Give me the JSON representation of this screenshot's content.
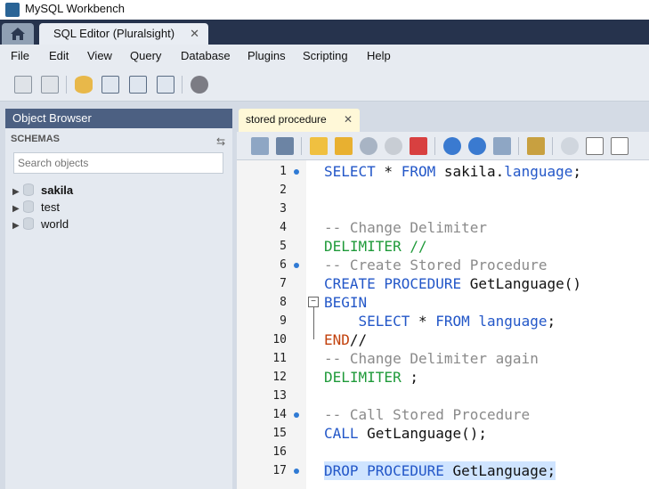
{
  "app": {
    "title": "MySQL Workbench"
  },
  "tabs": {
    "main_tab": "SQL Editor (Pluralsight)"
  },
  "menu": [
    "File",
    "Edit",
    "View",
    "Query",
    "Database",
    "Plugins",
    "Scripting",
    "Help"
  ],
  "object_browser": {
    "title": "Object Browser",
    "schemas_label": "SCHEMAS",
    "search_placeholder": "Search objects",
    "schemas": [
      "sakila",
      "test",
      "world"
    ]
  },
  "editor": {
    "tab_label": "stored procedure",
    "lines": [
      {
        "n": "1",
        "dot": true
      },
      {
        "n": "2",
        "dot": false
      },
      {
        "n": "3",
        "dot": false
      },
      {
        "n": "4",
        "dot": false
      },
      {
        "n": "5",
        "dot": false
      },
      {
        "n": "6",
        "dot": true
      },
      {
        "n": "7",
        "dot": false
      },
      {
        "n": "8",
        "dot": false
      },
      {
        "n": "9",
        "dot": false
      },
      {
        "n": "10",
        "dot": false
      },
      {
        "n": "11",
        "dot": false
      },
      {
        "n": "12",
        "dot": false
      },
      {
        "n": "13",
        "dot": false
      },
      {
        "n": "14",
        "dot": true
      },
      {
        "n": "15",
        "dot": false
      },
      {
        "n": "16",
        "dot": false
      },
      {
        "n": "17",
        "dot": true
      }
    ],
    "code": {
      "l1a": "SELECT",
      "l1b": " * ",
      "l1c": "FROM",
      "l1d": " sakila.",
      "l1e": "language",
      "l1f": ";",
      "l4": "-- Change Delimiter",
      "l5": "DELIMITER //",
      "l6": "-- Create Stored Procedure",
      "l7a": "CREATE",
      "l7b": " PROCEDURE",
      "l7c": " GetLanguage()",
      "l8": "BEGIN",
      "l9a": "    SELECT",
      "l9b": " * ",
      "l9c": "FROM",
      "l9d": " language",
      ";": ";",
      "l9e": ";",
      "l10a": "END",
      "l10b": "//",
      "l11": "-- Change Delimiter again",
      "l12a": "DELIMITER",
      "l12b": " ;",
      "l14": "-- Call Stored Procedure",
      "l15a": "CALL",
      "l15b": " GetLanguage();",
      "l17a": "DROP",
      "l17b": " PROCEDURE",
      "l17c": " GetLanguage;"
    }
  },
  "colors": {
    "keyword": "#2357c8",
    "comment": "#8a8a8a",
    "delimiter": "#1f9a3a",
    "end": "#c2410c",
    "selection": "#cfe4ff"
  }
}
